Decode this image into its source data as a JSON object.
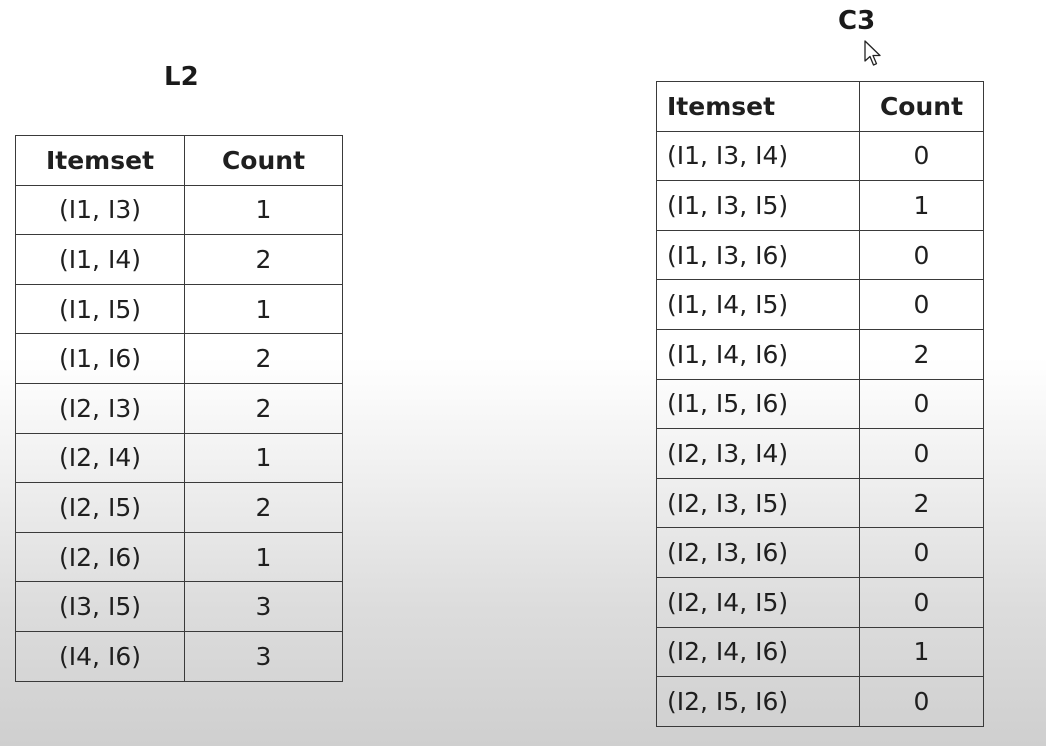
{
  "l2": {
    "title": "L2",
    "headers": {
      "itemset": "Itemset",
      "count": "Count"
    },
    "rows": [
      {
        "itemset": "(I1, I3)",
        "count": "1"
      },
      {
        "itemset": "(I1, I4)",
        "count": "2"
      },
      {
        "itemset": "(I1, I5)",
        "count": "1"
      },
      {
        "itemset": "(I1, I6)",
        "count": "2"
      },
      {
        "itemset": "(I2, I3)",
        "count": "2"
      },
      {
        "itemset": "(I2, I4)",
        "count": "1"
      },
      {
        "itemset": "(I2, I5)",
        "count": "2"
      },
      {
        "itemset": "(I2, I6)",
        "count": "1"
      },
      {
        "itemset": "(I3, I5)",
        "count": "3"
      },
      {
        "itemset": "(I4, I6)",
        "count": "3"
      }
    ]
  },
  "c3": {
    "title": "C3",
    "headers": {
      "itemset": "Itemset",
      "count": "Count"
    },
    "rows": [
      {
        "itemset": "(I1, I3, I4)",
        "count": "0"
      },
      {
        "itemset": "(I1, I3, I5)",
        "count": "1"
      },
      {
        "itemset": "(I1, I3, I6)",
        "count": "0"
      },
      {
        "itemset": "(I1, I4, I5)",
        "count": "0"
      },
      {
        "itemset": "(I1, I4, I6)",
        "count": "2"
      },
      {
        "itemset": "(I1, I5, I6)",
        "count": "0"
      },
      {
        "itemset": "(I2, I3, I4)",
        "count": "0"
      },
      {
        "itemset": "(I2, I3, I5)",
        "count": "2"
      },
      {
        "itemset": "(I2, I3, I6)",
        "count": "0"
      },
      {
        "itemset": "(I2, I4, I5)",
        "count": "0"
      },
      {
        "itemset": "(I2, I4, I6)",
        "count": "1"
      },
      {
        "itemset": "(I2, I5, I6)",
        "count": "0"
      }
    ]
  },
  "cursor": {
    "icon": "mouse-pointer-icon"
  }
}
